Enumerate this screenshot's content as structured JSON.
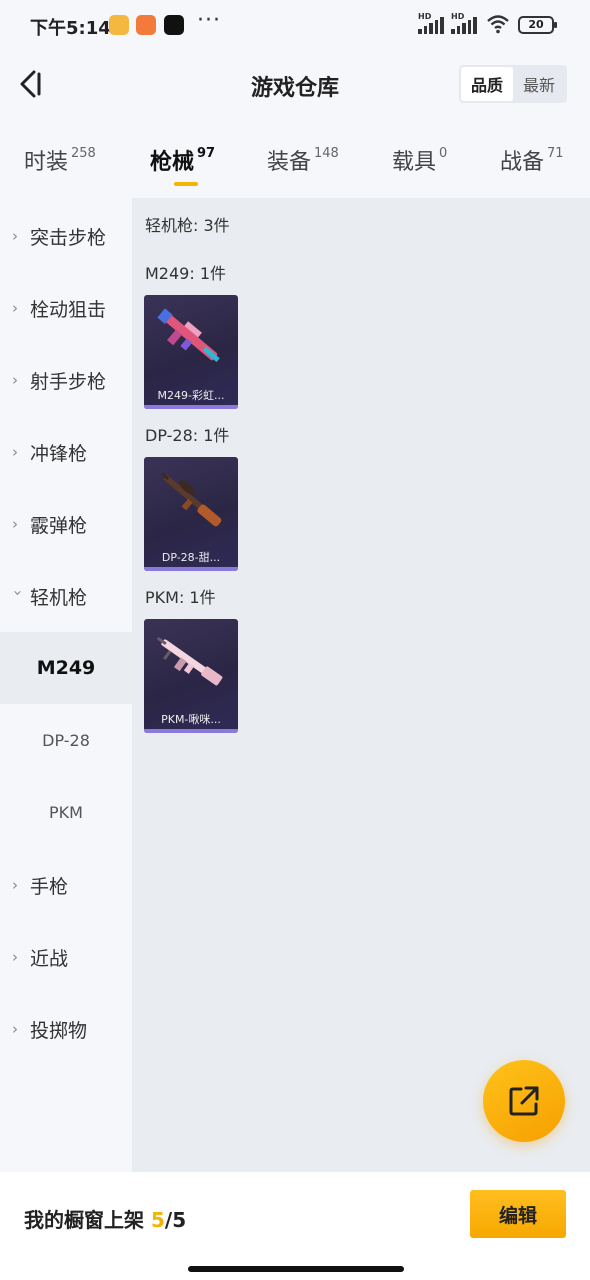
{
  "status_bar": {
    "time": "下午5:14",
    "network": [
      "HD",
      "HD"
    ],
    "battery": "20"
  },
  "header": {
    "title": "游戏仓库",
    "sort_options": [
      "品质",
      "最新"
    ],
    "sort_selected": "品质"
  },
  "tabs": [
    {
      "label": "时装",
      "count": "258"
    },
    {
      "label": "枪械",
      "count": "97",
      "active": true
    },
    {
      "label": "装备",
      "count": "148"
    },
    {
      "label": "载具",
      "count": "0"
    },
    {
      "label": "战备",
      "count": "71"
    }
  ],
  "sidebar": {
    "items": [
      {
        "label": "突击步枪"
      },
      {
        "label": "栓动狙击"
      },
      {
        "label": "射手步枪"
      },
      {
        "label": "冲锋枪"
      },
      {
        "label": "霰弹枪"
      },
      {
        "label": "轻机枪",
        "expanded": true
      },
      {
        "label": "手枪"
      },
      {
        "label": "近战"
      },
      {
        "label": "投掷物"
      }
    ],
    "sub_items": [
      "M249",
      "DP-28",
      "PKM"
    ],
    "active_sub": "M249"
  },
  "content": {
    "summary": "轻机枪: 3件",
    "groups": [
      {
        "label": "M249: 1件",
        "item": "M249-彩虹..."
      },
      {
        "label": "DP-28: 1件",
        "item": "DP-28-甜..."
      },
      {
        "label": "PKM: 1件",
        "item": "PKM-啾咪..."
      }
    ]
  },
  "bottom_bar": {
    "showcase_label": "我的橱窗上架",
    "showcase_count": "5",
    "showcase_total": "/5",
    "edit_label": "编辑"
  },
  "icons": {
    "back": "chevron-left-icon",
    "share": "external-link-icon"
  },
  "colors": {
    "accent": "#f5b400",
    "card_bg": "#2b2645"
  }
}
